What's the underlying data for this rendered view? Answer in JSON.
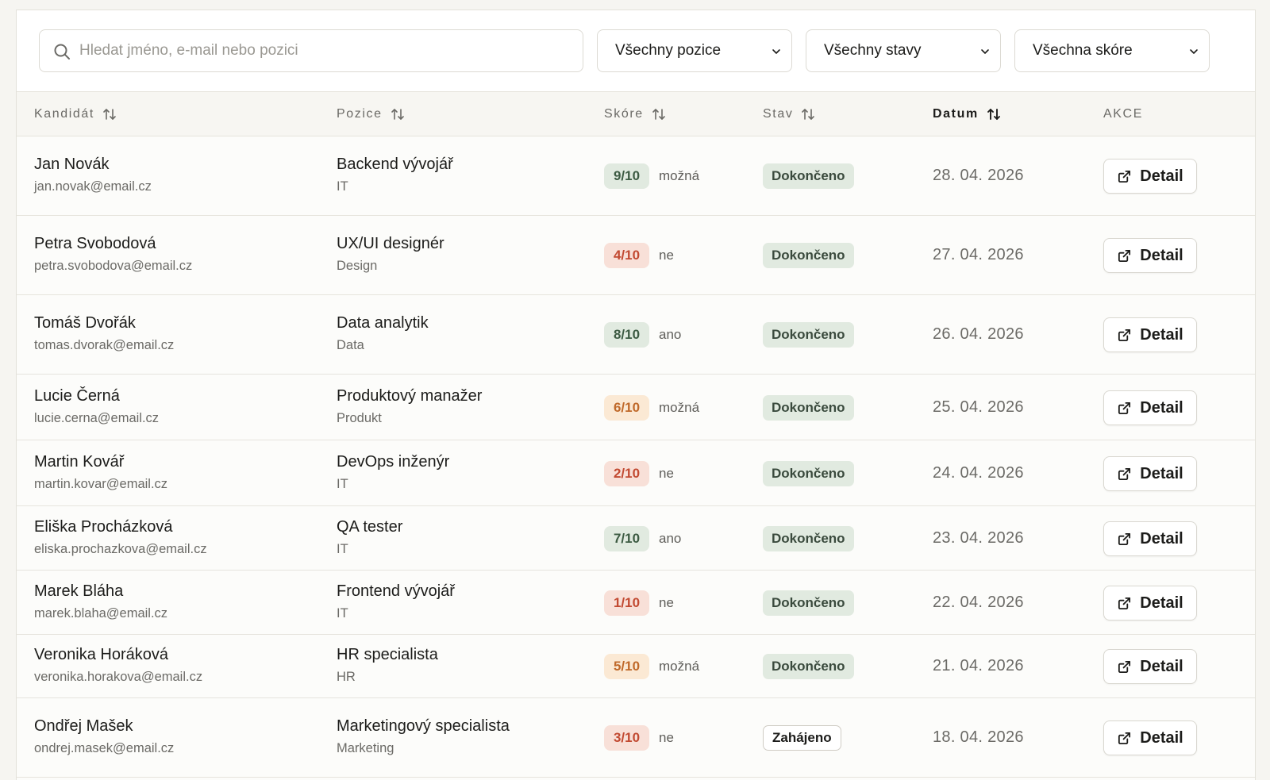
{
  "filters": {
    "search_placeholder": "Hledat jméno, e-mail nebo pozici",
    "search_value": "",
    "position_select": "Všechny pozice",
    "status_select": "Všechny stavy",
    "score_select": "Všechna skóre"
  },
  "table": {
    "headers": {
      "candidate": "Kandidát",
      "position": "Pozice",
      "score": "Skóre",
      "status": "Stav",
      "date": "Datum",
      "actions": "AKCE"
    },
    "active_sort_column": "date",
    "action_label": "Detail",
    "rows": [
      {
        "name": "Jan Novák",
        "email": "jan.novak@email.cz",
        "position": "Backend vývojář",
        "department": "IT",
        "score": "9/10",
        "score_level": "high",
        "verdict": "možná",
        "status": "Dokončeno",
        "status_kind": "done",
        "date": "28. 04. 2026"
      },
      {
        "name": "Petra Svobodová",
        "email": "petra.svobodova@email.cz",
        "position": "UX/UI designér",
        "department": "Design",
        "score": "4/10",
        "score_level": "low",
        "verdict": "ne",
        "status": "Dokončeno",
        "status_kind": "done",
        "date": "27. 04. 2026"
      },
      {
        "name": "Tomáš Dvořák",
        "email": "tomas.dvorak@email.cz",
        "position": "Data analytik",
        "department": "Data",
        "score": "8/10",
        "score_level": "high",
        "verdict": "ano",
        "status": "Dokončeno",
        "status_kind": "done",
        "date": "26. 04. 2026"
      },
      {
        "name": "Lucie Černá",
        "email": "lucie.cerna@email.cz",
        "position": "Produktový manažer",
        "department": "Produkt",
        "score": "6/10",
        "score_level": "mid",
        "verdict": "možná",
        "status": "Dokončeno",
        "status_kind": "done",
        "date": "25. 04. 2026"
      },
      {
        "name": "Martin Kovář",
        "email": "martin.kovar@email.cz",
        "position": "DevOps inženýr",
        "department": "IT",
        "score": "2/10",
        "score_level": "low",
        "verdict": "ne",
        "status": "Dokončeno",
        "status_kind": "done",
        "date": "24. 04. 2026"
      },
      {
        "name": "Eliška Procházková",
        "email": "eliska.prochazkova@email.cz",
        "position": "QA tester",
        "department": "IT",
        "score": "7/10",
        "score_level": "high",
        "verdict": "ano",
        "status": "Dokončeno",
        "status_kind": "done",
        "date": "23. 04. 2026"
      },
      {
        "name": "Marek Bláha",
        "email": "marek.blaha@email.cz",
        "position": "Frontend vývojář",
        "department": "IT",
        "score": "1/10",
        "score_level": "low",
        "verdict": "ne",
        "status": "Dokončeno",
        "status_kind": "done",
        "date": "22. 04. 2026"
      },
      {
        "name": "Veronika Horáková",
        "email": "veronika.horakova@email.cz",
        "position": "HR specialista",
        "department": "HR",
        "score": "5/10",
        "score_level": "mid",
        "verdict": "možná",
        "status": "Dokončeno",
        "status_kind": "done",
        "date": "21. 04. 2026"
      },
      {
        "name": "Ondřej Mašek",
        "email": "ondrej.masek@email.cz",
        "position": "Marketingový specialista",
        "department": "Marketing",
        "score": "3/10",
        "score_level": "low",
        "verdict": "ne",
        "status": "Zahájeno",
        "status_kind": "started",
        "date": "18. 04. 2026"
      }
    ]
  },
  "colors": {
    "score_high_bg": "#e1eae0",
    "score_mid_bg": "#fbe9d4",
    "score_low_bg": "#f8e0d8",
    "status_done_bg": "#e1eae0"
  }
}
